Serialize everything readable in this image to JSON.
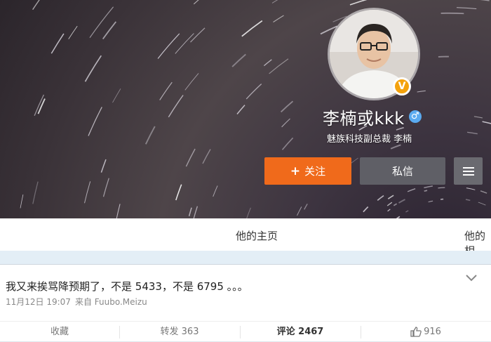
{
  "profile": {
    "name": "李楠或kkk",
    "bio": "魅族科技副总裁 李楠",
    "verified_badge": "V",
    "gender_symbol": "♂"
  },
  "buttons": {
    "follow_plus": "+",
    "follow_label": "关注",
    "message_label": "私信"
  },
  "tabs": {
    "home": "他的主页",
    "next_partial": "他的相"
  },
  "post": {
    "text": "我又来挨骂降预期了，不是 5433，不是 6795 。。。",
    "date": "11月12日 19:07",
    "source_prefix": "来自",
    "source": "Fuubo.Meizu"
  },
  "actions": {
    "favorite": "收藏",
    "repost": "转发 363",
    "comment": "评论 2467",
    "like": "916"
  },
  "colors": {
    "follow": "#f06a1b",
    "message": "#5f5f66",
    "verified": "#f4a20c",
    "gender": "#5aaaf0"
  },
  "icons": {
    "verified": "verified-badge-icon",
    "gender": "male-icon",
    "menu": "hamburger-icon",
    "expand": "chevron-down-icon",
    "like": "thumbs-up-icon"
  }
}
